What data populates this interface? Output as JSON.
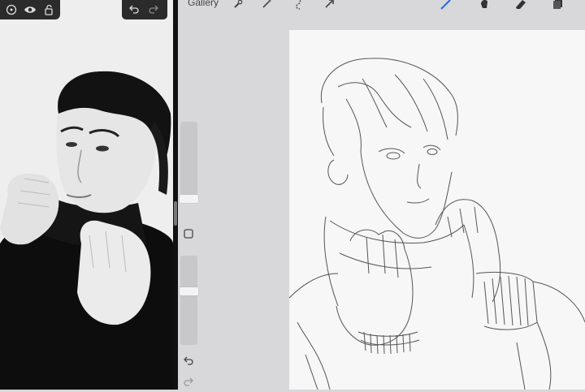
{
  "reference": {
    "toolbar_icons": [
      "target-icon",
      "eye-icon",
      "lock-icon"
    ]
  },
  "procreate": {
    "gallery_label": "Gallery",
    "toolbar_left_icons": [
      "wrench-icon",
      "magic-wand-icon",
      "selection-icon",
      "transform-arrow-icon"
    ],
    "toolbar_right_icons": [
      "brush-icon",
      "smudge-icon",
      "eraser-icon",
      "layers-icon"
    ],
    "accent_color": "#2f6fe0"
  }
}
